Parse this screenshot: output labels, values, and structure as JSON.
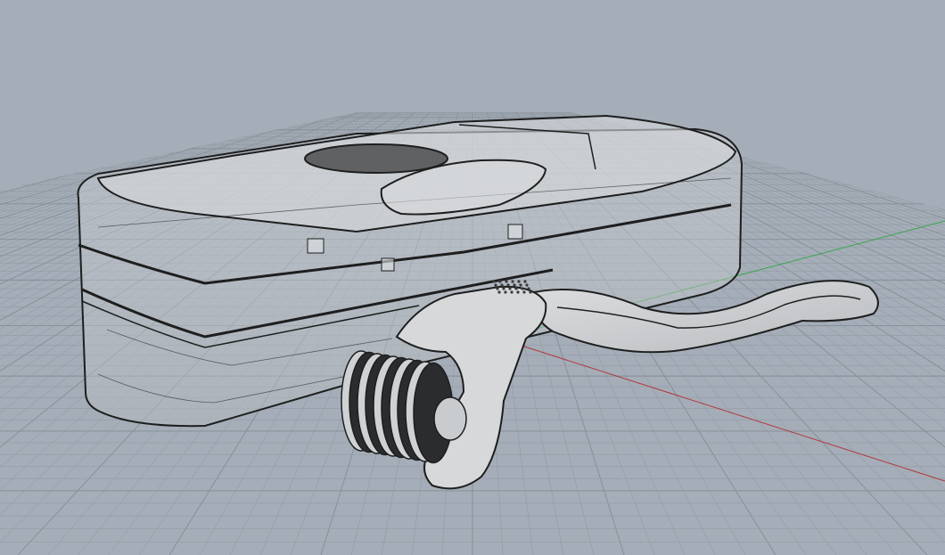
{
  "viewport": {
    "background_color": "#a4adb8",
    "grid_color": "#8f989f",
    "grid_major_color": "#858d95",
    "x_axis_color": "#b2383a",
    "y_axis_color": "#3aa64a",
    "model_fill_color": "#c8cbcf",
    "model_edge_color": "#1e1e1e"
  },
  "objects": [
    "storage-case",
    "derma-roller"
  ]
}
